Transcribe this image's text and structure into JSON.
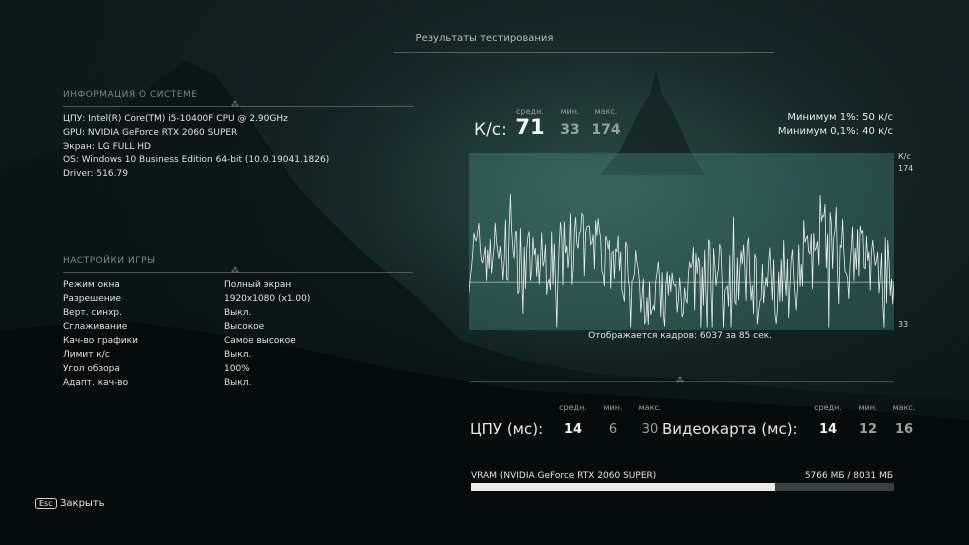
{
  "header": {
    "title": "Результаты тестирования"
  },
  "system": {
    "heading": "ИНФОРМАЦИЯ О СИСТЕМЕ",
    "lines": [
      "ЦПУ: Intel(R) Core(TM) i5-10400F CPU @ 2.90GHz",
      "GPU: NVIDIA GeForce RTX 2060 SUPER",
      "Экран: LG FULL HD",
      "OS: Windows 10 Business Edition 64-bit (10.0.19041.1826)",
      "Driver: 516.79"
    ]
  },
  "settings": {
    "heading": "НАСТРОЙКИ ИГРЫ",
    "rows": [
      {
        "label": "Режим окна",
        "value": "Полный экран"
      },
      {
        "label": "Разрешение",
        "value": "1920x1080 (x1.00)"
      },
      {
        "label": "Верт. синхр.",
        "value": "Выкл."
      },
      {
        "label": "Сглаживание",
        "value": "Высокое"
      },
      {
        "label": "Кач-во графики",
        "value": "Самое высокое"
      },
      {
        "label": "Лимит к/с",
        "value": "Выкл."
      },
      {
        "label": "Угол обзора",
        "value": "100%"
      },
      {
        "label": "Адапт. кач-во",
        "value": "Выкл."
      }
    ]
  },
  "fps": {
    "label": "К/с:",
    "avg_label": "средн.",
    "min_label": "мин.",
    "max_label": "макс.",
    "avg": "71",
    "min": "33",
    "max": "174",
    "low1": "Минимум 1%: 50 к/с",
    "low01": "Минимум 0,1%: 40 к/с"
  },
  "chart_data": {
    "type": "line",
    "ylabel": "К/с",
    "ylim": [
      33,
      174
    ],
    "ytick_top": "174",
    "ytick_bottom": "33",
    "duration_sec": 85,
    "line_color": "#e8ecea",
    "avg_line": 71,
    "frames_text": "Отображается кадров: 6037 за 85 сек."
  },
  "cpu": {
    "label": "ЦПУ (мс):",
    "avg_label": "средн.",
    "min_label": "мин.",
    "max_label": "макс.",
    "avg": "14",
    "min": "6",
    "max": "30"
  },
  "gpu": {
    "label": "Видеокарта (мс):",
    "avg_label": "средн.",
    "min_label": "мин.",
    "max_label": "макс.",
    "avg": "14",
    "min": "12",
    "max": "16"
  },
  "vram": {
    "label": "VRAM (NVIDIA GeForce RTX 2060 SUPER)",
    "value": "5766 МБ / 8031 МБ",
    "fraction": 0.718
  },
  "footer": {
    "key": "Esc",
    "close_label": "Закрыть"
  },
  "colors": {
    "accent": "#e8ebea",
    "graph_bg": "#3d6e68"
  }
}
